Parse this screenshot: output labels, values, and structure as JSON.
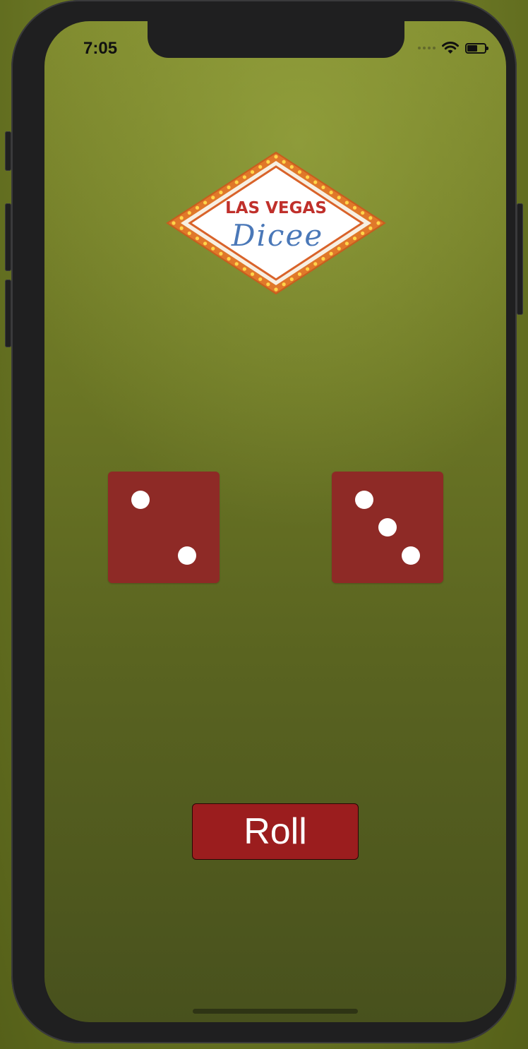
{
  "status_bar": {
    "time": "7:05",
    "icons": [
      "signal-icon",
      "wifi-icon",
      "battery-icon"
    ],
    "battery_level": 0.6
  },
  "logo": {
    "line1": "LAS VEGAS",
    "line2": "Dicee"
  },
  "dice": [
    {
      "value": 2
    },
    {
      "value": 3
    }
  ],
  "roll_button": {
    "label": "Roll"
  },
  "colors": {
    "felt": "#6c7725",
    "die": "#8e2a26",
    "button": "#9b1d1e",
    "logo_red": "#c0302b",
    "logo_blue": "#4a78b8",
    "logo_orange": "#e0782a"
  }
}
